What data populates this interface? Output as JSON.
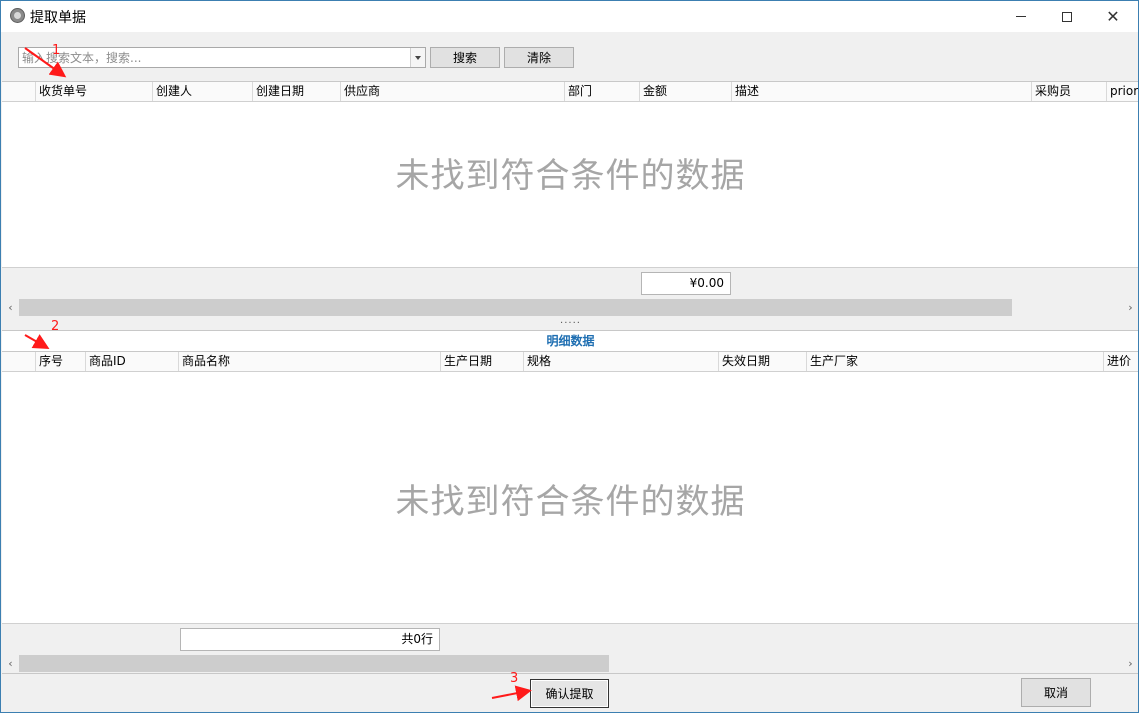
{
  "window": {
    "title": "提取单据",
    "icon": "app-icon",
    "controls": {
      "minimize": "minimize-icon",
      "maximize": "maximize-icon",
      "close": "close-icon"
    }
  },
  "search": {
    "placeholder": "输入搜索文本，搜索...",
    "value": "",
    "search_label": "搜索",
    "clear_label": "清除"
  },
  "master_grid": {
    "columns": [
      "收货单号",
      "创建人",
      "创建日期",
      "供应商",
      "部门",
      "金额",
      "描述",
      "采购员",
      "priori"
    ],
    "empty_message": "未找到符合条件的数据",
    "total_amount": "¥0.00"
  },
  "splitter": {
    "label": "....."
  },
  "detail_grid": {
    "title": "明细数据",
    "columns": [
      "序号",
      "商品ID",
      "商品名称",
      "生产日期",
      "规格",
      "失效日期",
      "生产厂家",
      "进价"
    ],
    "empty_message": "未找到符合条件的数据",
    "row_count": "共0行"
  },
  "actions": {
    "confirm_label": "确认提取",
    "cancel_label": "取消"
  },
  "annotations": {
    "n1": "1",
    "n2": "2",
    "n3": "3",
    "color": "#ff1a1a"
  },
  "scroll": {
    "left_arrow": "‹",
    "right_arrow": "›"
  }
}
